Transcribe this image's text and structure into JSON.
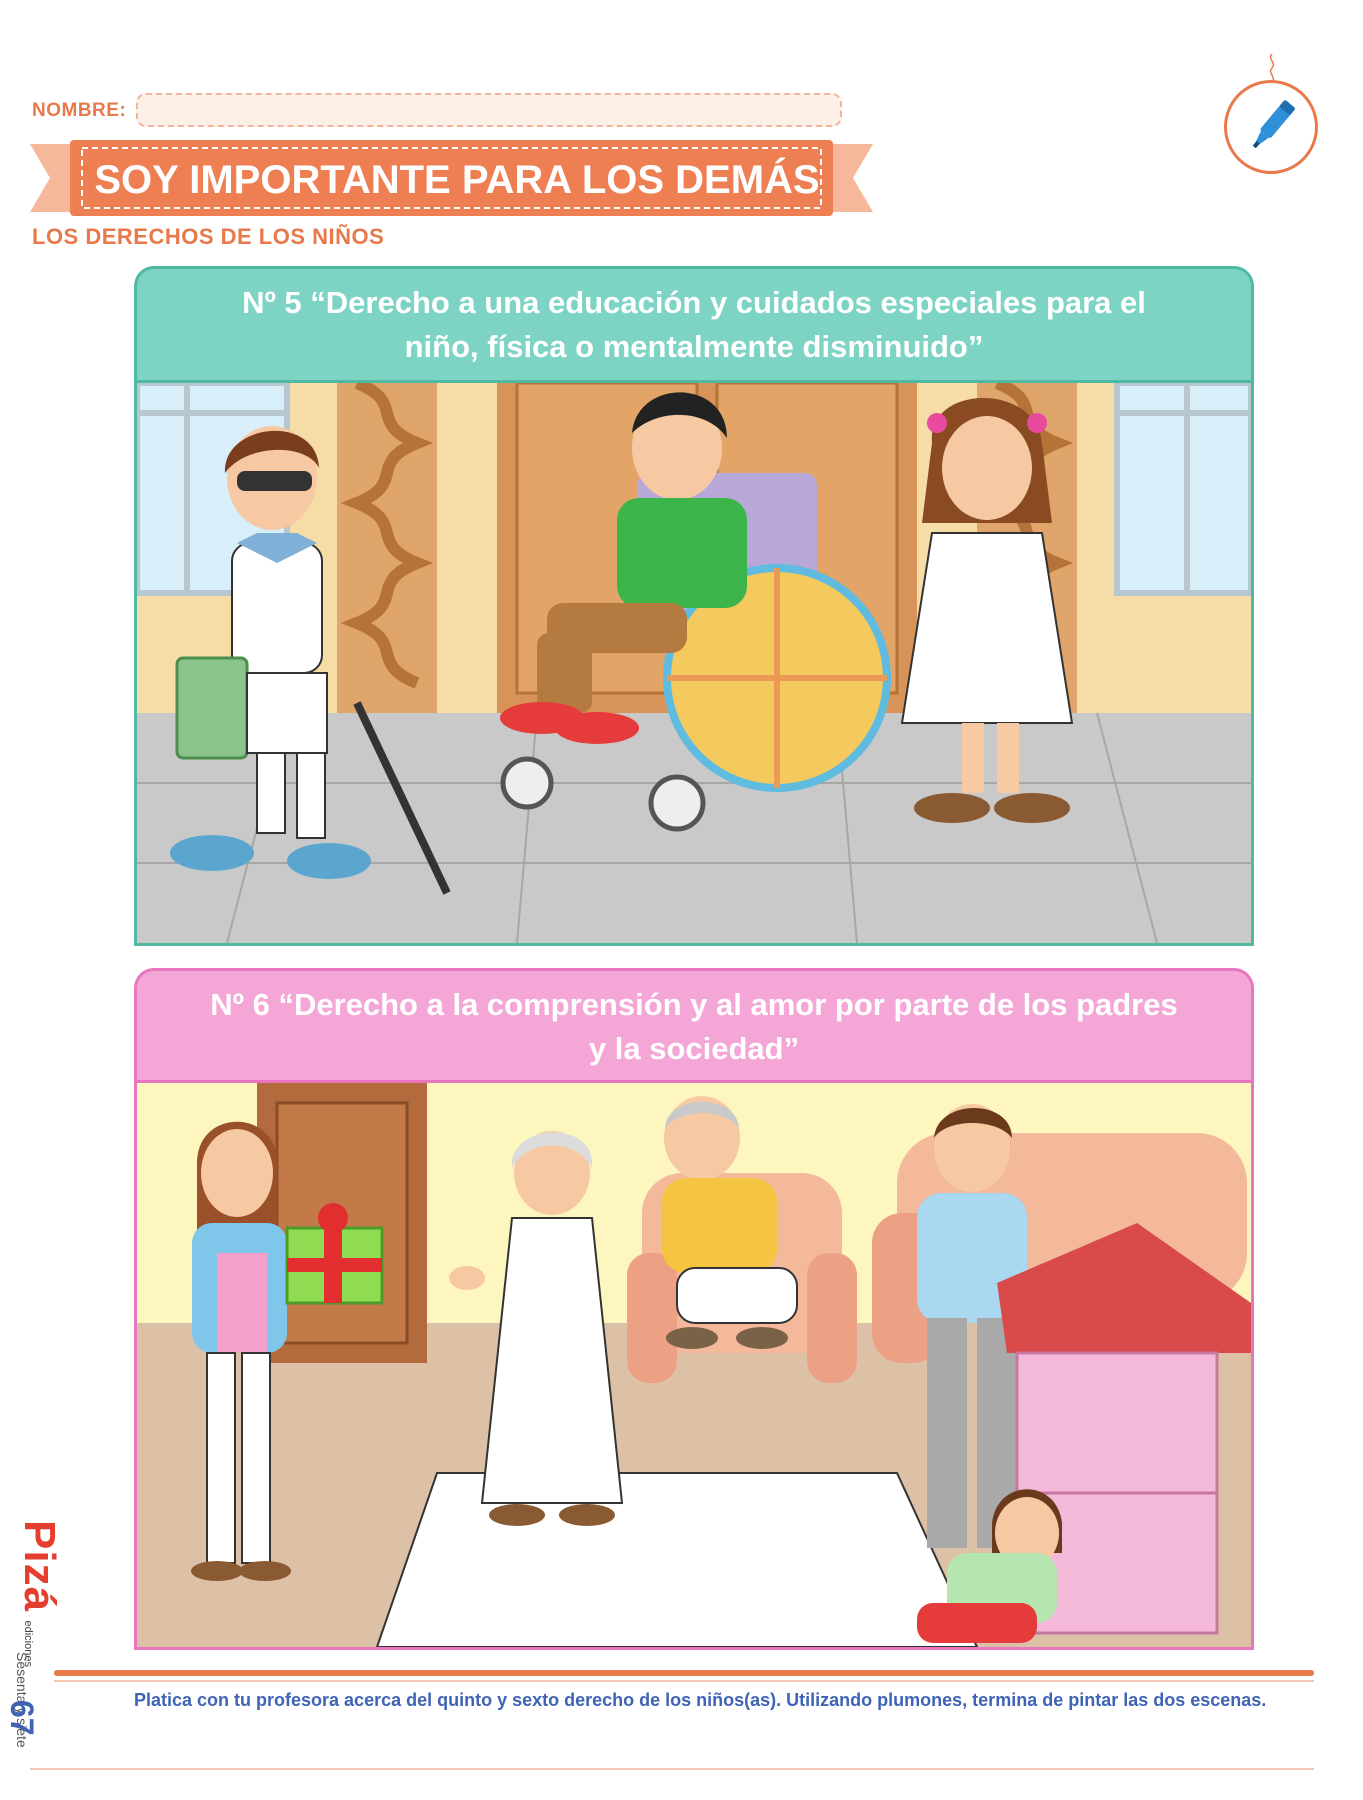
{
  "header": {
    "name_label": "NOMBRE:",
    "name_value": "",
    "title": "SOY IMPORTANTE PARA LOS DEMÁS",
    "subtitle": "LOS DERECHOS DE LOS NIÑOS",
    "icon": "marker-pen-icon"
  },
  "panels": [
    {
      "heading": "Nº 5 “Derecho a una educación y cuidados especiales para el niño, física o mentalmente disminuido”",
      "heading_line1": "Nº 5 “Derecho a una educación y cuidados especiales para el",
      "heading_line2": "niño, física o mentalmente disminuido”",
      "color": "#7dd3c4",
      "border_color": "#4fb9a4",
      "scene": "school-corridor-illustration"
    },
    {
      "heading": "Nº 6 “Derecho a la comprensión y al amor por parte de los padres y la sociedad”",
      "heading_line1": "Nº 6 “Derecho a la comprensión y al amor por parte de los padres",
      "heading_line2": "y la sociedad”",
      "color": "#f4a6d6",
      "border_color": "#e876bf",
      "scene": "family-living-room-illustration"
    }
  ],
  "footer": {
    "instruction": "Platica con tu profesora acerca del quinto y sexto derecho de los niños(as). Utilizando plumones, termina de pintar las dos escenas.",
    "page_number": "67",
    "page_words": "Sesenta y siete",
    "brand": "Pizá",
    "brand_sub": "ediciones"
  },
  "colors": {
    "accent_orange": "#e8794a",
    "accent_blue": "#3f63b5",
    "brand_red": "#e53d2e"
  }
}
